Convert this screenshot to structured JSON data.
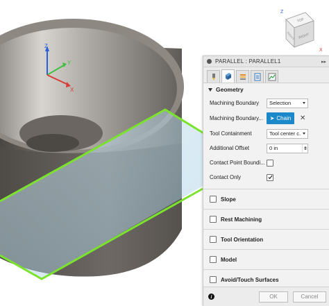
{
  "viewcube": {
    "top_label": "TOP",
    "front_label": "RIGHT",
    "side_label": "RIGHT",
    "axis_z": "Z",
    "axis_x": "X"
  },
  "triad": {
    "z": "Z",
    "y": "Y",
    "x": "X"
  },
  "panel": {
    "title": "PARALLEL : PARALLEL1",
    "tabs": [
      "tool-tab",
      "geometry-tab",
      "heights-tab",
      "passes-tab",
      "linking-tab"
    ],
    "geometry": {
      "heading": "Geometry",
      "machining_boundary_label": "Machining Boundary",
      "machining_boundary_value": "Selection",
      "machining_boundary_sel_label": "Machining Boundary...",
      "chain_button": "Chain",
      "tool_containment_label": "Tool Containment",
      "tool_containment_value": "Tool center c...",
      "additional_offset_label": "Additional Offset",
      "additional_offset_value": "0 in",
      "contact_point_label": "Contact Point Boundi...",
      "contact_point_checked": false,
      "contact_only_label": "Contact Only",
      "contact_only_checked": true
    },
    "groups": [
      {
        "label": "Slope",
        "checked": false
      },
      {
        "label": "Rest Machining",
        "checked": false
      },
      {
        "label": "Tool Orientation",
        "checked": false
      },
      {
        "label": "Model",
        "checked": false
      },
      {
        "label": "Avoid/Touch Surfaces",
        "checked": false
      }
    ],
    "footer": {
      "ok": "OK",
      "cancel": "Cancel"
    }
  },
  "colors": {
    "accent": "#1a88c9",
    "boundary": "#7be32e",
    "part_body": "#8a857f"
  }
}
